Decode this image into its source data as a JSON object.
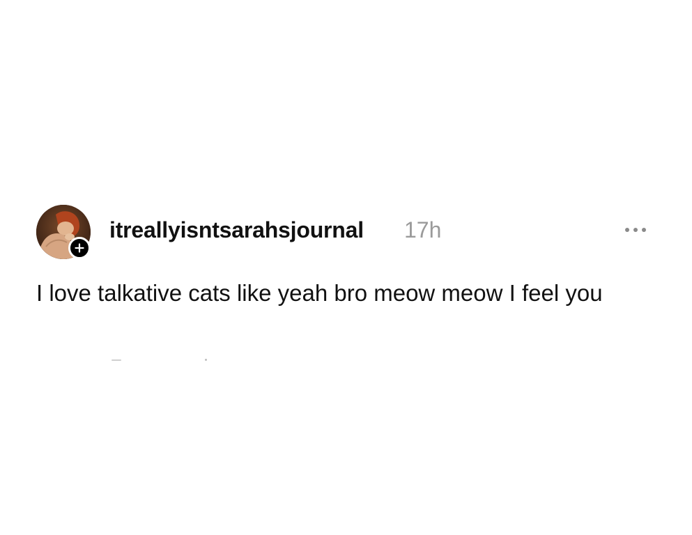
{
  "post": {
    "author": {
      "username": "itreallyisntsarahsjournal",
      "avatar_icon": "profile-photo",
      "follow_icon": "plus-icon"
    },
    "timestamp": "17h",
    "more_icon": "ellipsis-icon",
    "text": "I love talkative cats like yeah bro meow meow I feel you"
  },
  "colors": {
    "background": "#ffffff",
    "text": "#111111",
    "muted": "#9a9a9a",
    "badge": "#000000"
  }
}
